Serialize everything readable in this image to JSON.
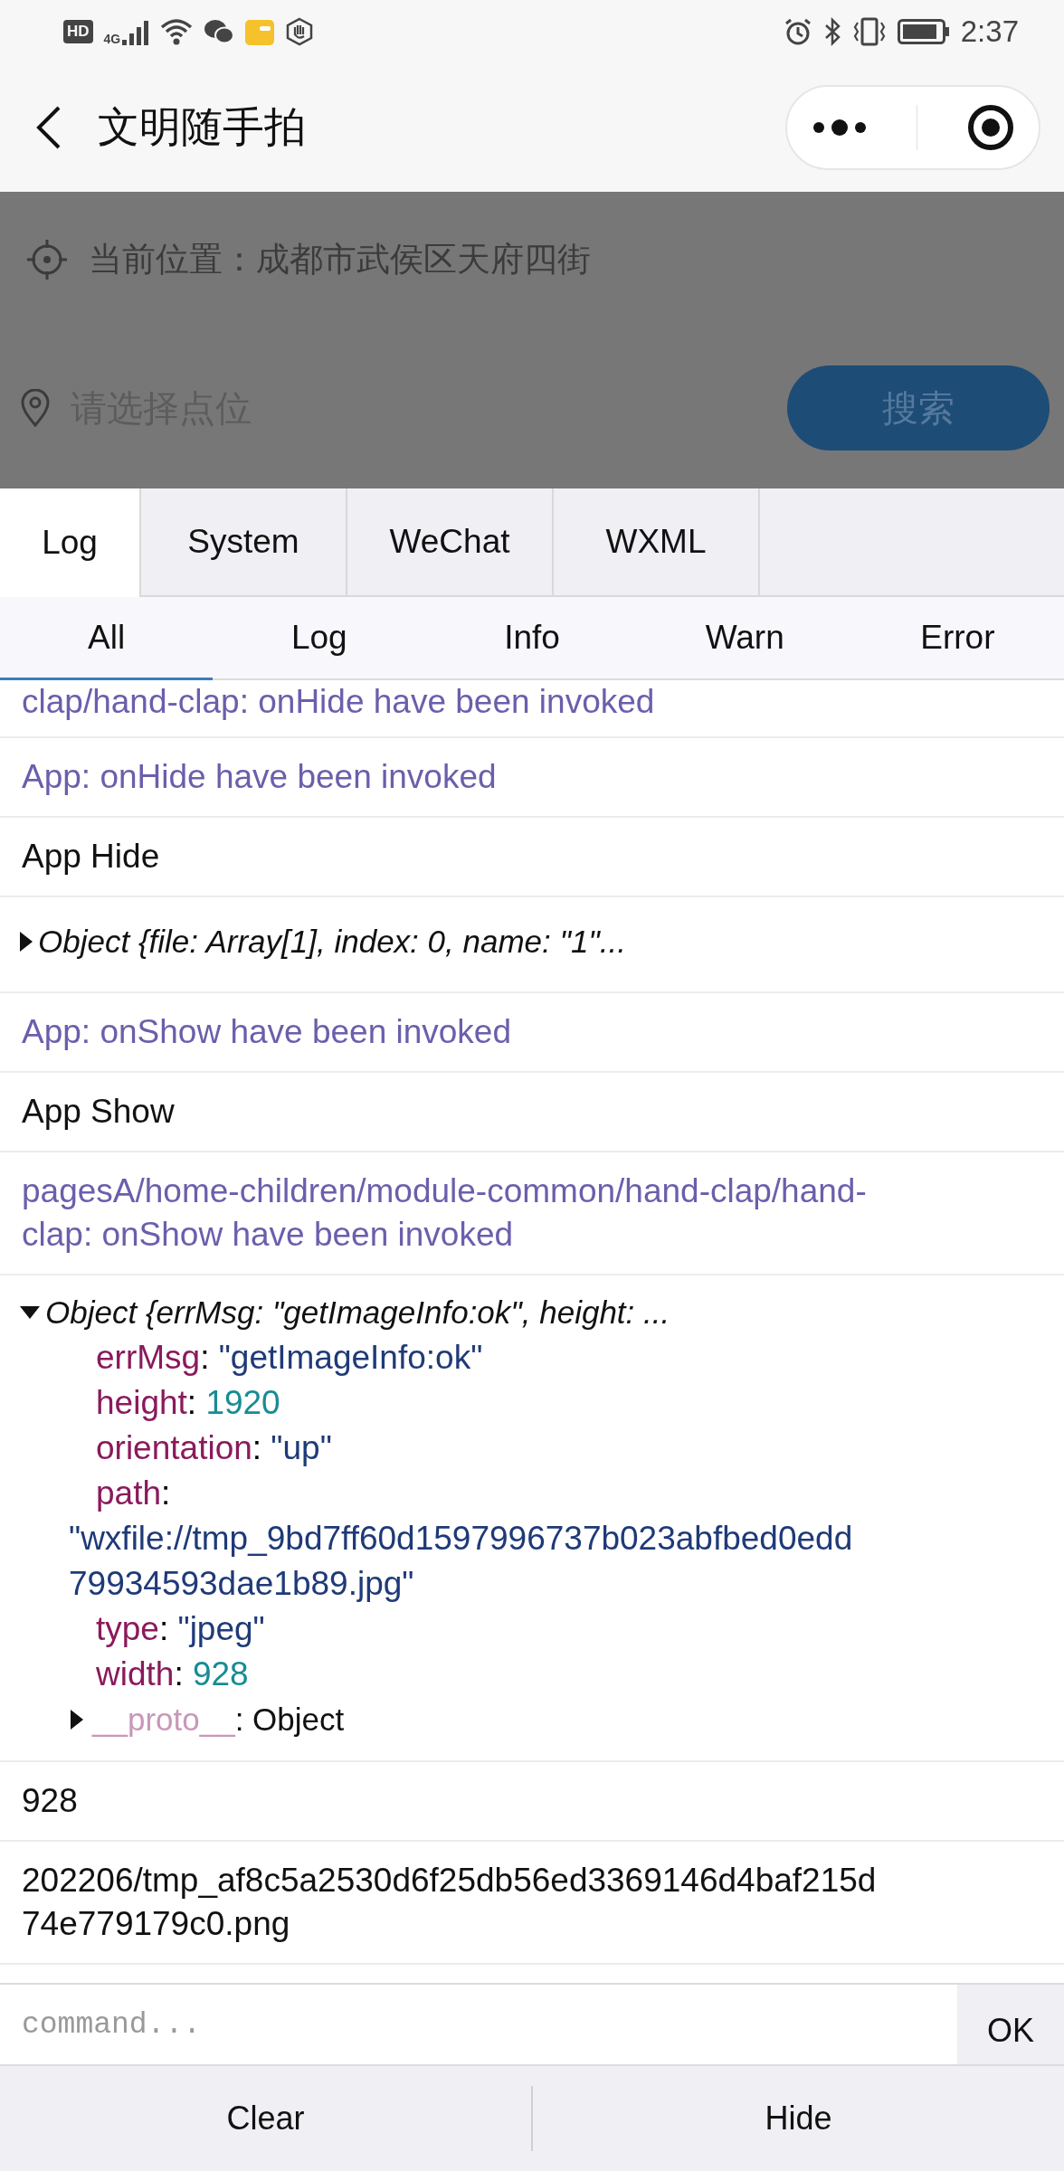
{
  "status_bar": {
    "badge": "HD",
    "network": "4G",
    "time": "2:37"
  },
  "nav": {
    "title": "文明随手拍"
  },
  "page": {
    "location": "当前位置：成都市武侯区天府四街",
    "search": {
      "placeholder": "请选择点位"
    },
    "search_button": "搜索"
  },
  "tabs": [
    {
      "label": "Log",
      "selected": true
    },
    {
      "label": "System",
      "selected": false
    },
    {
      "label": "WeChat",
      "selected": false
    },
    {
      "label": "WXML",
      "selected": false
    }
  ],
  "filters": [
    {
      "label": "All",
      "selected": true
    },
    {
      "label": "Log",
      "selected": false
    },
    {
      "label": "Info",
      "selected": false
    },
    {
      "label": "Warn",
      "selected": false
    },
    {
      "label": "Error",
      "selected": false
    }
  ],
  "logs": [
    {
      "kind": "info",
      "text": "clap/hand-clap: onHide have been invoked"
    },
    {
      "kind": "info",
      "text": "App: onHide have been invoked"
    },
    {
      "kind": "plain",
      "text": "App Hide"
    },
    {
      "kind": "object",
      "expanded": false,
      "summary": "Object {file: Array[1], index: 0, name: \"1\"..."
    },
    {
      "kind": "info",
      "text": "App: onShow have been invoked"
    },
    {
      "kind": "plain",
      "text": "App Show"
    },
    {
      "kind": "info",
      "text": "pagesA/home-children/module-common/hand-clap/hand-clap: onShow have been invoked"
    },
    {
      "kind": "object",
      "expanded": true,
      "summary": "Object {errMsg: \"getImageInfo:ok\", height: ...",
      "properties": [
        {
          "key": "errMsg",
          "sep": ":",
          "value": "\"getImageInfo:ok\"",
          "kind": "string"
        },
        {
          "key": "height",
          "sep": ":",
          "value": "1920",
          "kind": "number"
        },
        {
          "key": "orientation",
          "sep": ":",
          "value": "\"up\"",
          "kind": "string"
        },
        {
          "key": "path",
          "sep": ":",
          "value": "\"wxfile://tmp_9bd7ff60d1597996737b023abfbed0edd79934593dae1b89.jpg\"",
          "kind": "string"
        },
        {
          "key": "type",
          "sep": ":",
          "value": "\"jpeg\"",
          "kind": "string"
        },
        {
          "key": "width",
          "sep": ":",
          "value": "928",
          "kind": "number"
        },
        {
          "key": "__proto__",
          "sep": ":",
          "value": "Object",
          "kind": "proto",
          "expanded": false
        }
      ]
    },
    {
      "kind": "plain",
      "text": "928"
    },
    {
      "kind": "plain",
      "text": "202206/tmp_af8c5a2530d6f25db56ed3369146d4baf215d74e779179c0.png"
    }
  ],
  "command": {
    "placeholder": "command...",
    "button": "OK"
  },
  "footer_buttons": [
    "Clear",
    "Hide"
  ]
}
